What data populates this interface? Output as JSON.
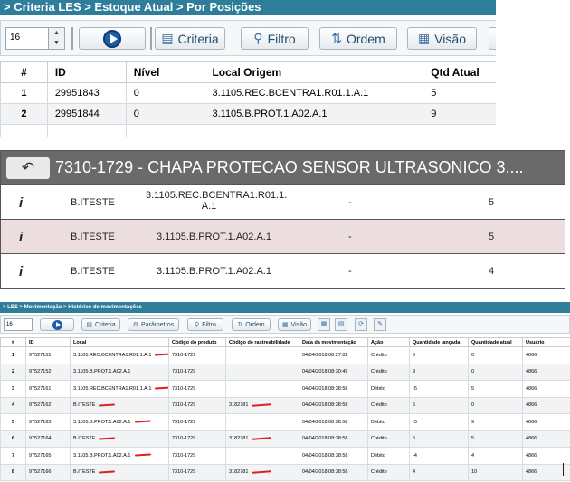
{
  "panel1": {
    "breadcrumb": "> Criteria LES > Estoque Atual > Por Posições",
    "toolbar": {
      "spinner_value": "16",
      "criteria_label": "Criteria",
      "filtro_label": "Filtro",
      "ordem_label": "Ordem",
      "visao_label": "Visão"
    },
    "headers": [
      "#",
      "ID",
      "Nível",
      "Local Origem",
      "Qtd Atual"
    ],
    "rows": [
      {
        "num": "1",
        "id": "29951843",
        "nivel": "0",
        "local": "3.1105.REC.BCENTRA1.R01.1.A.1",
        "qtd": "5"
      },
      {
        "num": "2",
        "id": "29951844",
        "nivel": "0",
        "local": "3.1105.B.PROT.1.A02.A.1",
        "qtd": "9"
      }
    ]
  },
  "panel2": {
    "back_icon": "↶",
    "title": "7310-1729 - CHAPA PROTECAO SENSOR ULTRASONICO 3....",
    "rows": [
      {
        "info": "i",
        "user": "B.ITESTE",
        "local_line1": "3.1105.REC.BCENTRA1.R01.1.",
        "local_line2": "A.1",
        "dash": "-",
        "qty": "5"
      },
      {
        "info": "i",
        "user": "B.ITESTE",
        "local": "3.1105.B.PROT.1.A02.A.1",
        "dash": "-",
        "qty": "5"
      },
      {
        "info": "i",
        "user": "B.ITESTE",
        "local": "3.1105.B.PROT.1.A02.A.1",
        "dash": "-",
        "qty": "4"
      }
    ]
  },
  "panel3": {
    "breadcrumb": "> LES > Movimentação > Histórico de movimentações",
    "toolbar": {
      "spinner_value": "16",
      "criteria_label": "Criteria",
      "parametros_label": "Parâmetros",
      "filtro_label": "Filtro",
      "ordem_label": "Ordem",
      "visao_label": "Visão"
    },
    "headers": [
      "#",
      "ID",
      "Local",
      "Código do produto",
      "Código de rastreabilidade",
      "Data da movimentação",
      "Ação",
      "Quantidade lançada",
      "Quantidade atual",
      "Usuário"
    ],
    "rows": [
      {
        "num": "1",
        "id": "97527151",
        "local": "3.1105.REC.BCENTRA1.R01.1.A.1",
        "produto": "7310-1729",
        "rastreio": "",
        "data": "04/04/2018 08:27:02",
        "acao": "Crédito",
        "lancada": "5",
        "atual": "0",
        "usuario": "4866"
      },
      {
        "num": "2",
        "id": "97527152",
        "local": "3.1105.B.PROT.1.A02.A.1",
        "produto": "7310-1729",
        "rastreio": "",
        "data": "04/04/2018 08:30:49",
        "acao": "Crédito",
        "lancada": "9",
        "atual": "0",
        "usuario": "4866"
      },
      {
        "num": "3",
        "id": "97527161",
        "local": "3.1105.REC.BCENTRA1.R01.1.A.1",
        "produto": "7310-1729",
        "rastreio": "",
        "data": "04/04/2018 08:38:58",
        "acao": "Débito",
        "lancada": "-5",
        "atual": "5",
        "usuario": "4866"
      },
      {
        "num": "4",
        "id": "97527162",
        "local": "B.ITESTE",
        "produto": "7310-1729",
        "rastreio": "3182781",
        "data": "04/04/2018 08:38:58",
        "acao": "Crédito",
        "lancada": "5",
        "atual": "0",
        "usuario": "4866"
      },
      {
        "num": "5",
        "id": "97527163",
        "local": "3.1105.B.PROT.1.A02.A.1",
        "produto": "7310-1729",
        "rastreio": "",
        "data": "04/04/2018 08:38:58",
        "acao": "Débito",
        "lancada": "-5",
        "atual": "9",
        "usuario": "4866"
      },
      {
        "num": "6",
        "id": "97527164",
        "local": "B.ITESTE",
        "produto": "7310-1729",
        "rastreio": "3182781",
        "data": "04/04/2018 08:38:58",
        "acao": "Crédito",
        "lancada": "5",
        "atual": "5",
        "usuario": "4866"
      },
      {
        "num": "7",
        "id": "97527165",
        "local": "3.1105.B.PROT.1.A02.A.1",
        "produto": "7310-1729",
        "rastreio": "",
        "data": "04/04/2018 08:38:58",
        "acao": "Débito",
        "lancada": "-4",
        "atual": "4",
        "usuario": "4866"
      },
      {
        "num": "8",
        "id": "97527166",
        "local": "B.ITESTE",
        "produto": "7310-1729",
        "rastreio": "3182781",
        "data": "04/04/2018 08:38:58",
        "acao": "Crédito",
        "lancada": "4",
        "atual": "10",
        "usuario": "4866"
      }
    ]
  }
}
